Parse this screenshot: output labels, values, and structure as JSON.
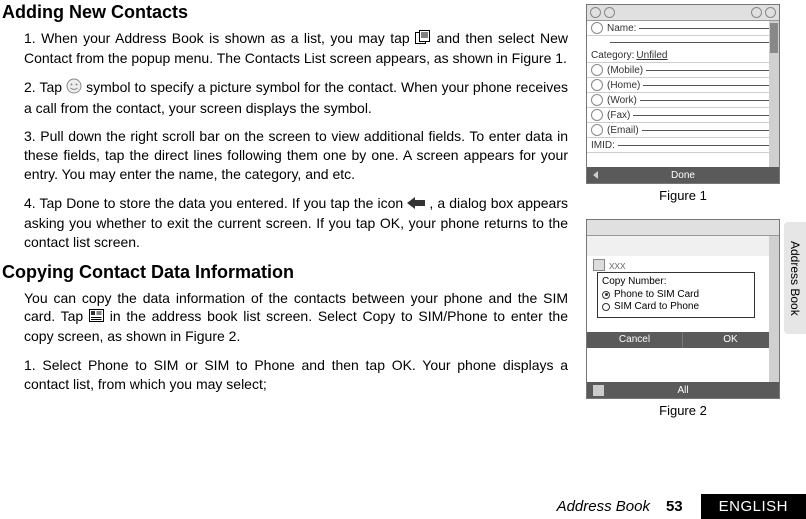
{
  "headings": {
    "h1": "Adding New Contacts",
    "h2": "Copying Contact Data Information"
  },
  "steps1": {
    "s1a": "1. When your Address Book is shown as a list, you may tap ",
    "s1b": " and then select New Contact from the popup menu. The Contacts List screen appears, as shown in Figure 1.",
    "s2a": "2. Tap ",
    "s2b": " symbol to specify a picture symbol for the contact. When your phone receives a call from the contact, your screen displays the symbol.",
    "s3": "3. Pull down the right scroll bar on the screen to view additional fields. To enter data in these fields, tap the direct lines following them one by one. A screen appears for your entry. You may enter the name, the category, and etc.",
    "s4a": "4. Tap Done to store the data you entered. If you tap the icon ",
    "s4b": " , a dialog box appears asking you whether to exit the current screen. If you tap OK, your phone returns to the contact list screen."
  },
  "copy": {
    "p1a": "You can copy the data information of the contacts between your phone and the SIM card. Tap ",
    "p1b": " in the address book list screen. Select Copy to SIM/Phone to enter the copy screen, as shown in Figure 2.",
    "p2": "1. Select Phone to SIM or SIM to Phone and then tap OK. Your phone displays a contact list, from which you may select;"
  },
  "phone1": {
    "name_label": "Name:",
    "category_label": "Category:",
    "category_value": "Unfiled",
    "fields": {
      "mobile": "(Mobile)",
      "home": "(Home)",
      "work": "(Work)",
      "fax": "(Fax)",
      "email": "(Email)"
    },
    "imid_label": "IMID:",
    "done_label": "Done"
  },
  "phone2": {
    "xxx": "xxx",
    "dialog_title": "Copy Number:",
    "opt1": "Phone to SIM Card",
    "opt2": "SIM Card to Phone",
    "cancel": "Cancel",
    "ok": "OK",
    "tab_all": "All"
  },
  "captions": {
    "fig1": "Figure 1",
    "fig2": "Figure 2"
  },
  "sidetab": "Address Book",
  "footer": {
    "section": "Address Book",
    "page": "53",
    "lang": "ENGLISH"
  }
}
